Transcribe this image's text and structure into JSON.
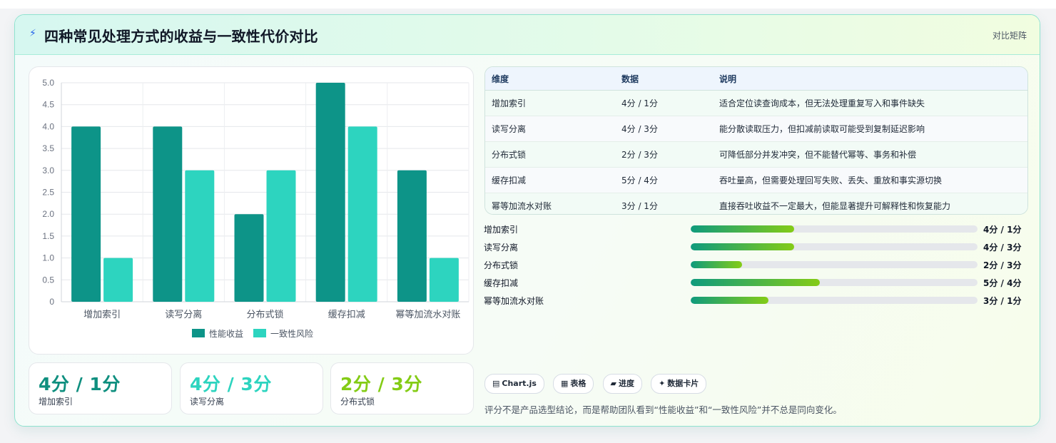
{
  "header": {
    "icon": "lightning-icon",
    "title": "四种常见处理方式的收益与一致性代价对比",
    "tag": "对比矩阵"
  },
  "chart_data": {
    "type": "bar",
    "categories": [
      "增加索引",
      "读写分离",
      "分布式锁",
      "缓存扣减",
      "幂等加流水对账"
    ],
    "series": [
      {
        "name": "性能收益",
        "values": [
          4,
          4,
          2,
          5,
          3
        ],
        "color": "#0d9488"
      },
      {
        "name": "一致性风险",
        "values": [
          1,
          3,
          3,
          4,
          1
        ],
        "color": "#2dd4bf"
      }
    ],
    "ylim": [
      0,
      5
    ],
    "yticks": [
      "0",
      "0.5",
      "1.0",
      "1.5",
      "2.0",
      "2.5",
      "3.0",
      "3.5",
      "4.0",
      "4.5",
      "5.0"
    ],
    "grid": true,
    "legend": "bottom"
  },
  "stats": [
    {
      "value": "4分 / 1分",
      "label": "增加索引",
      "color": "#0f8f7f"
    },
    {
      "value": "4分 / 3分",
      "label": "读写分离",
      "color": "#2dd4bf"
    },
    {
      "value": "2分 / 3分",
      "label": "分布式锁",
      "color": "#84cc16"
    }
  ],
  "table": {
    "headers": [
      "维度",
      "数据",
      "说明"
    ],
    "rows": [
      [
        "增加索引",
        "4分 / 1分",
        "适合定位读查询成本，但无法处理重复写入和事件缺失"
      ],
      [
        "读写分离",
        "4分 / 3分",
        "能分散读取压力，但扣减前读取可能受到复制延迟影响"
      ],
      [
        "分布式锁",
        "2分 / 3分",
        "可降低部分并发冲突，但不能替代幂等、事务和补偿"
      ],
      [
        "缓存扣减",
        "5分 / 4分",
        "吞吐量高，但需要处理回写失败、丢失、重放和事实源切换"
      ],
      [
        "幂等加流水对账",
        "3分 / 1分",
        "直接吞吐收益不一定最大，但能显著提升可解释性和恢复能力"
      ]
    ]
  },
  "progress": [
    {
      "label": "增加索引",
      "value": "4分 / 1分",
      "fraction": 0.36
    },
    {
      "label": "读写分离",
      "value": "4分 / 3分",
      "fraction": 0.36
    },
    {
      "label": "分布式锁",
      "value": "2分 / 3分",
      "fraction": 0.18
    },
    {
      "label": "缓存扣减",
      "value": "5分 / 4分",
      "fraction": 0.45
    },
    {
      "label": "幂等加流水对账",
      "value": "3分 / 1分",
      "fraction": 0.27
    }
  ],
  "chips": [
    {
      "icon": "chart-icon",
      "glyph": "▤",
      "label": "Chart.js"
    },
    {
      "icon": "table-icon",
      "glyph": "▦",
      "label": "表格"
    },
    {
      "icon": "progress-icon",
      "glyph": "▰",
      "label": "进度"
    },
    {
      "icon": "sparkle-icon",
      "glyph": "✦",
      "label": "数据卡片"
    }
  ],
  "footnote": "评分不是产品选型结论，而是帮助团队看到“性能收益”和“一致性风险”并不总是同向变化。"
}
